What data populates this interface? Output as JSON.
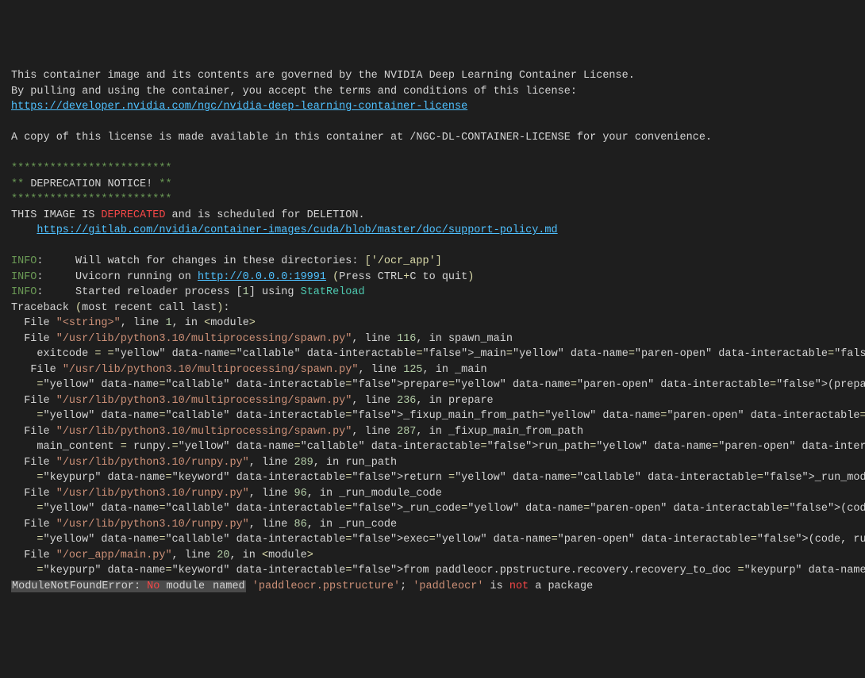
{
  "colors": {
    "background": "#1e1e1e",
    "foreground": "#d4d4d4",
    "green": "#6a9955",
    "red": "#f44747",
    "yellow": "#dcdcaa",
    "link": "#4fc1ff",
    "string": "#ce9178",
    "number": "#b5cea8",
    "purple": "#c586c0",
    "cyan": "#4ec9b0",
    "highlight": "#4a4a4a"
  },
  "license": {
    "line1": "This container image and its contents are governed by the NVIDIA Deep Learning Container License.",
    "line2": "By pulling and using the container, you accept the terms and conditions of this license:",
    "url": "https://developer.nvidia.com/ngc/nvidia-deep-learning-container-license",
    "copy_note": "A copy of this license is made available in this container at /NGC-DL-CONTAINER-LICENSE for your convenience."
  },
  "deprecation": {
    "stars_line": "*************************",
    "stars_side": "**",
    "notice_label": "DEPRECATION NOTICE!",
    "prefix": "THIS IMAGE IS ",
    "deprecated_word": "DEPRECATED",
    "suffix": " and is scheduled for DELETION.",
    "policy_url": "https://gitlab.com/nvidia/container-images/cuda/blob/master/doc/support-policy.md"
  },
  "info": {
    "label": "INFO",
    "colon": ":",
    "watch_prefix": "     Will watch for changes in these directories: ",
    "watch_dirs": "['/ocr_app']",
    "uvicorn_prefix": "     Uvicorn running on ",
    "uvicorn_url": "http://0.0.0.0:19991",
    "uvicorn_open": " (",
    "uvicorn_press": "Press CTRL",
    "uvicorn_plus": "+",
    "uvicorn_c": "C to quit",
    "uvicorn_close": ")",
    "reloader_prefix": "     Started reloader process [",
    "reloader_pid": "1",
    "reloader_mid": "] using ",
    "reloader_name": "StatReload"
  },
  "tb": {
    "header_pre": "Traceback ",
    "header_open": "(",
    "header_text": "most recent call last",
    "header_close": ")",
    "header_colon": ":",
    "frames": [
      {
        "indent": "  ",
        "file": "\"<string>\"",
        "line": "1",
        "func": "<module>",
        "code": ""
      },
      {
        "indent": "  ",
        "file": "\"/usr/lib/python3.10/multiprocessing/spawn.py\"",
        "line": "116",
        "func": "spawn_main",
        "code": "exitcode = _main(fd, parent_sentinel)"
      },
      {
        "indent": "   ",
        "file": "\"/usr/lib/python3.10/multiprocessing/spawn.py\"",
        "line": "125",
        "func": "_main",
        "code": "prepare(preparation_data)"
      },
      {
        "indent": "  ",
        "file": "\"/usr/lib/python3.10/multiprocessing/spawn.py\"",
        "line": "236",
        "func": "prepare",
        "code": "_fixup_main_from_path(data['init_main_from_path'])"
      },
      {
        "indent": "  ",
        "file": "\"/usr/lib/python3.10/multiprocessing/spawn.py\"",
        "line": "287",
        "func": "_fixup_main_from_path",
        "code": "main_content = runpy.run_path(main_path,"
      },
      {
        "indent": "  ",
        "file": "\"/usr/lib/python3.10/runpy.py\"",
        "line": "289",
        "func": "run_path",
        "code": "return _run_module_code(code, init_globals, run_name,"
      },
      {
        "indent": "  ",
        "file": "\"/usr/lib/python3.10/runpy.py\"",
        "line": "96",
        "func": "_run_module_code",
        "code": "_run_code(code, mod_globals, init_globals,"
      },
      {
        "indent": "  ",
        "file": "\"/usr/lib/python3.10/runpy.py\"",
        "line": "86",
        "func": "_run_code",
        "code": "exec(code, run_globals)"
      },
      {
        "indent": "  ",
        "file": "\"/ocr_app/main.py\"",
        "line": "20",
        "func": "<module>",
        "code": "from paddleocr.ppstructure.recovery.recovery_to_doc import sorted_layout_boxes  # 导入版面排序功能"
      }
    ],
    "error_name": "ModuleNotFoundError",
    "error_sep": ": ",
    "error_no": "No",
    "error_module_word": " module ",
    "error_named": "named",
    "error_pkg1": " 'paddleocr.ppstructure'",
    "error_semi": "; ",
    "error_pkg2": "'paddleocr'",
    "error_is": " is ",
    "error_not": "not",
    "error_tail": " a package"
  },
  "tokens": {
    "file_label": "File ",
    "line_label": ", line ",
    "in_label": ", in "
  }
}
